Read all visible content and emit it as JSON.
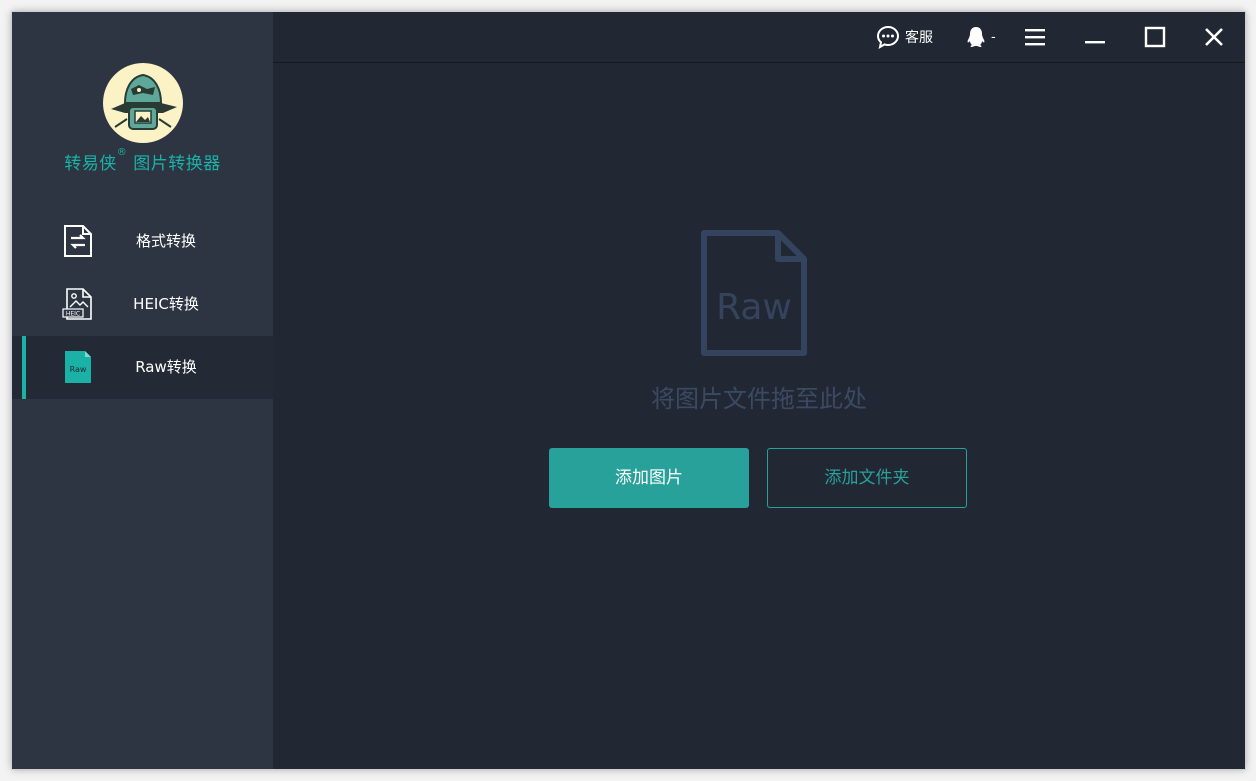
{
  "brand": {
    "name": "转易侠",
    "registered": "®",
    "product": "图片转换器",
    "accent_color": "#1ab2a7"
  },
  "sidebar": {
    "items": [
      {
        "label": "格式转换",
        "icon": "format-convert-icon",
        "active": false
      },
      {
        "label": "HEIC转换",
        "icon": "heic-file-icon",
        "active": false
      },
      {
        "label": "Raw转换",
        "icon": "raw-file-icon",
        "active": true
      }
    ]
  },
  "topbar": {
    "support_label": "客服",
    "user_label": "-",
    "icons": [
      "chat-bubble-icon",
      "user-icon",
      "menu-icon",
      "minimize-icon",
      "maximize-icon",
      "close-icon"
    ]
  },
  "main": {
    "drop_icon_text": "Raw",
    "drop_hint": "将图片文件拖至此处",
    "add_image_label": "添加图片",
    "add_folder_label": "添加文件夹"
  }
}
